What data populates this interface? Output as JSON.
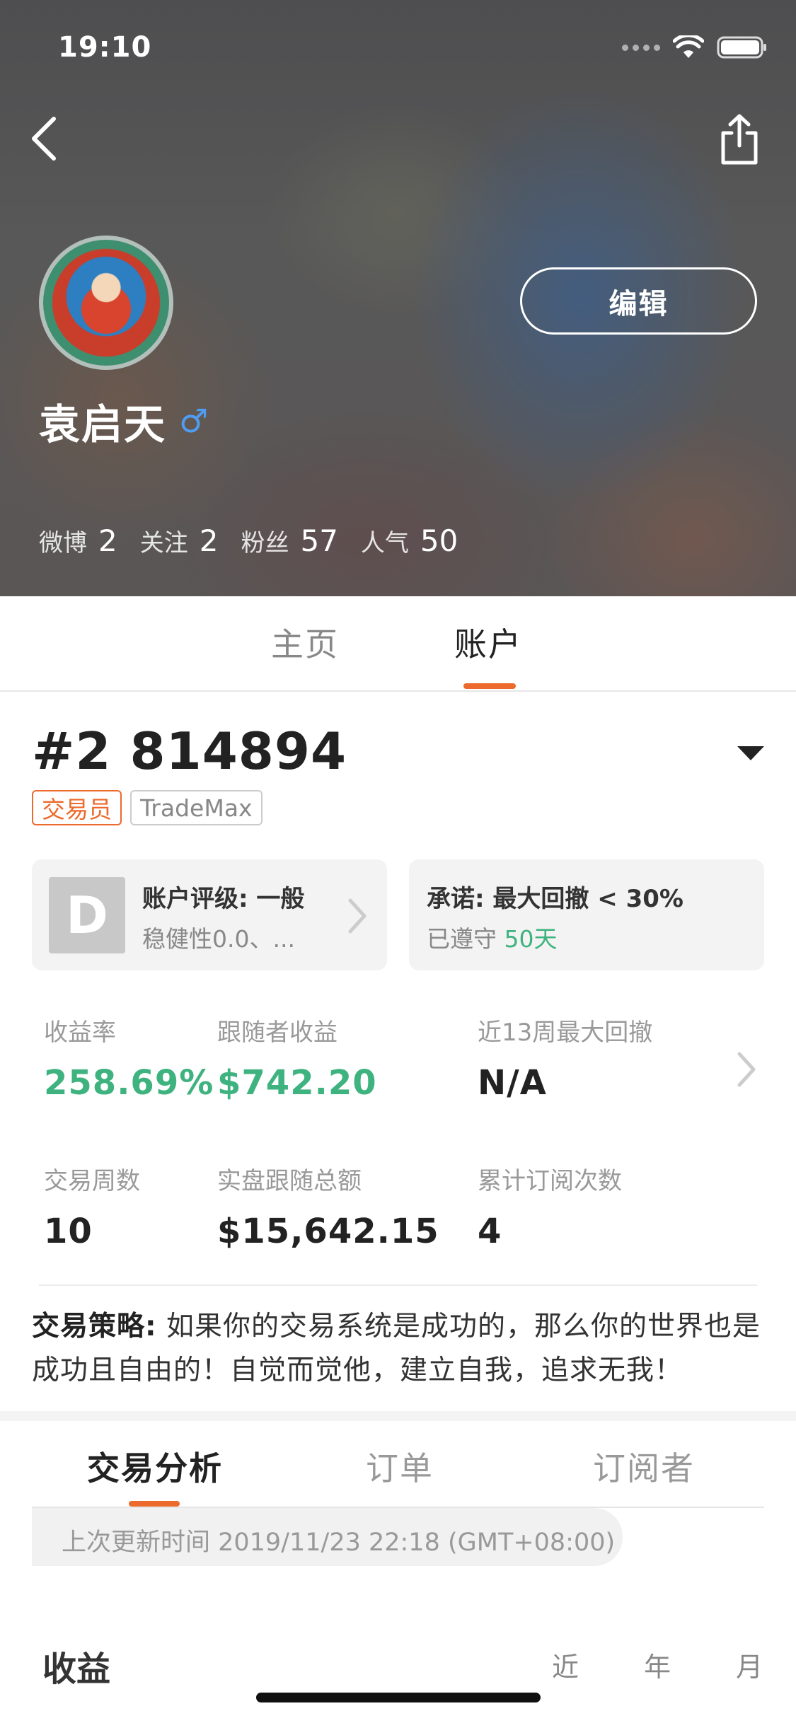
{
  "status_bar": {
    "time": "19:10"
  },
  "profile": {
    "name": "袁启天",
    "gender_symbol": "♂",
    "edit_label": "编辑",
    "stats": [
      {
        "label": "微博",
        "value": "2"
      },
      {
        "label": "关注",
        "value": "2"
      },
      {
        "label": "粉丝",
        "value": "57"
      },
      {
        "label": "人气",
        "value": "50"
      }
    ]
  },
  "main_tabs": {
    "home": "主页",
    "account": "账户",
    "active": "账户"
  },
  "account": {
    "number": "#2 814894",
    "role_tag": "交易员",
    "broker_tag": "TradeMax",
    "rating_card": {
      "badge": "D",
      "title": "账户评级: 一般",
      "subtitle": "稳健性0.0、..."
    },
    "promise_card": {
      "title": "承诺: 最大回撤 < 30%",
      "subtitle_prefix": "已遵守 ",
      "subtitle_value": "50天"
    },
    "metrics": {
      "return_rate": {
        "label": "收益率",
        "value": "258.69%"
      },
      "follower_profit": {
        "label": "跟随者收益",
        "value": "$742.20"
      },
      "max_drawdown_13w": {
        "label": "近13周最大回撤",
        "value": "N/A"
      },
      "trading_weeks": {
        "label": "交易周数",
        "value": "10"
      },
      "live_follow_total": {
        "label": "实盘跟随总额",
        "value": "$15,642.15"
      },
      "total_subscriptions": {
        "label": "累计订阅次数",
        "value": "4"
      }
    },
    "strategy": {
      "label": "交易策略:",
      "text": " 如果你的交易系统是成功的，那么你的世界也是成功且自由的！自觉而觉他，建立自我，追求无我！"
    }
  },
  "sub_tabs": {
    "analysis": "交易分析",
    "orders": "订单",
    "subscribers": "订阅者",
    "active": "交易分析"
  },
  "update_info": "上次更新时间 2019/11/23 22:18 (GMT+08:00)",
  "bottom_partial": {
    "label": "收益",
    "range_options": "近 年 月"
  },
  "colors": {
    "accent": "#ec6a2c",
    "positive": "#3fb37f",
    "gender": "#4f9df2"
  }
}
